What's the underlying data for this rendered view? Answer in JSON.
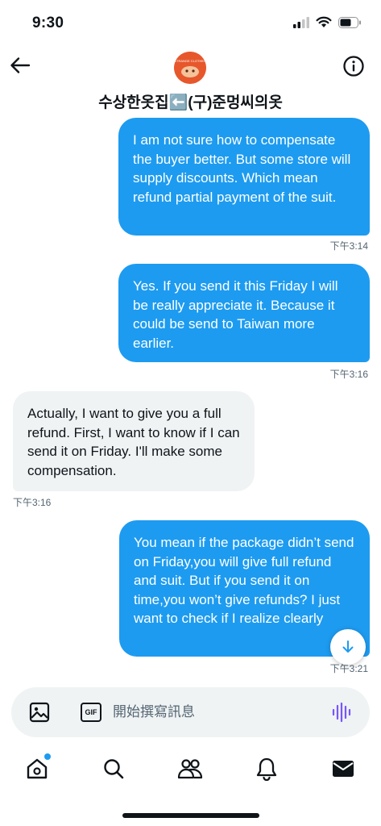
{
  "status_bar": {
    "time": "9:30"
  },
  "header": {
    "contact_name": "수상한옷집⬅️(구)준멍씨의옷",
    "avatar_text": "수상한"
  },
  "messages": [
    {
      "direction": "sent",
      "text": "I am not sure how to compensate the buyer better. But some store will supply discounts. Which mean refund partial payment of the suit.",
      "time": "下午3:14"
    },
    {
      "direction": "sent",
      "text": "Yes. If you send it this Friday I will be really appreciate it. Because it could be send to Taiwan more earlier.",
      "time": "下午3:16"
    },
    {
      "direction": "received",
      "text": "Actually, I want to give you a full refund. First, I want to know if I can send it on Friday. I'll make some compensation.",
      "time": "下午3:16"
    },
    {
      "direction": "sent",
      "text": "You mean if the package didn’t send on Friday,you will give full refund and suit. But if you send it on time,you won’t give refunds? I just want to check if I realize clearly",
      "time": "下午3:21"
    }
  ],
  "composer": {
    "placeholder": "開始撰寫訊息",
    "gif_label": "GIF"
  },
  "colors": {
    "accent": "#1d9bf0",
    "received_bubble": "#eff3f4",
    "voice_icon": "#7856ff"
  },
  "nav": [
    "home-icon",
    "search-icon",
    "communities-icon",
    "notifications-icon",
    "messages-icon"
  ]
}
